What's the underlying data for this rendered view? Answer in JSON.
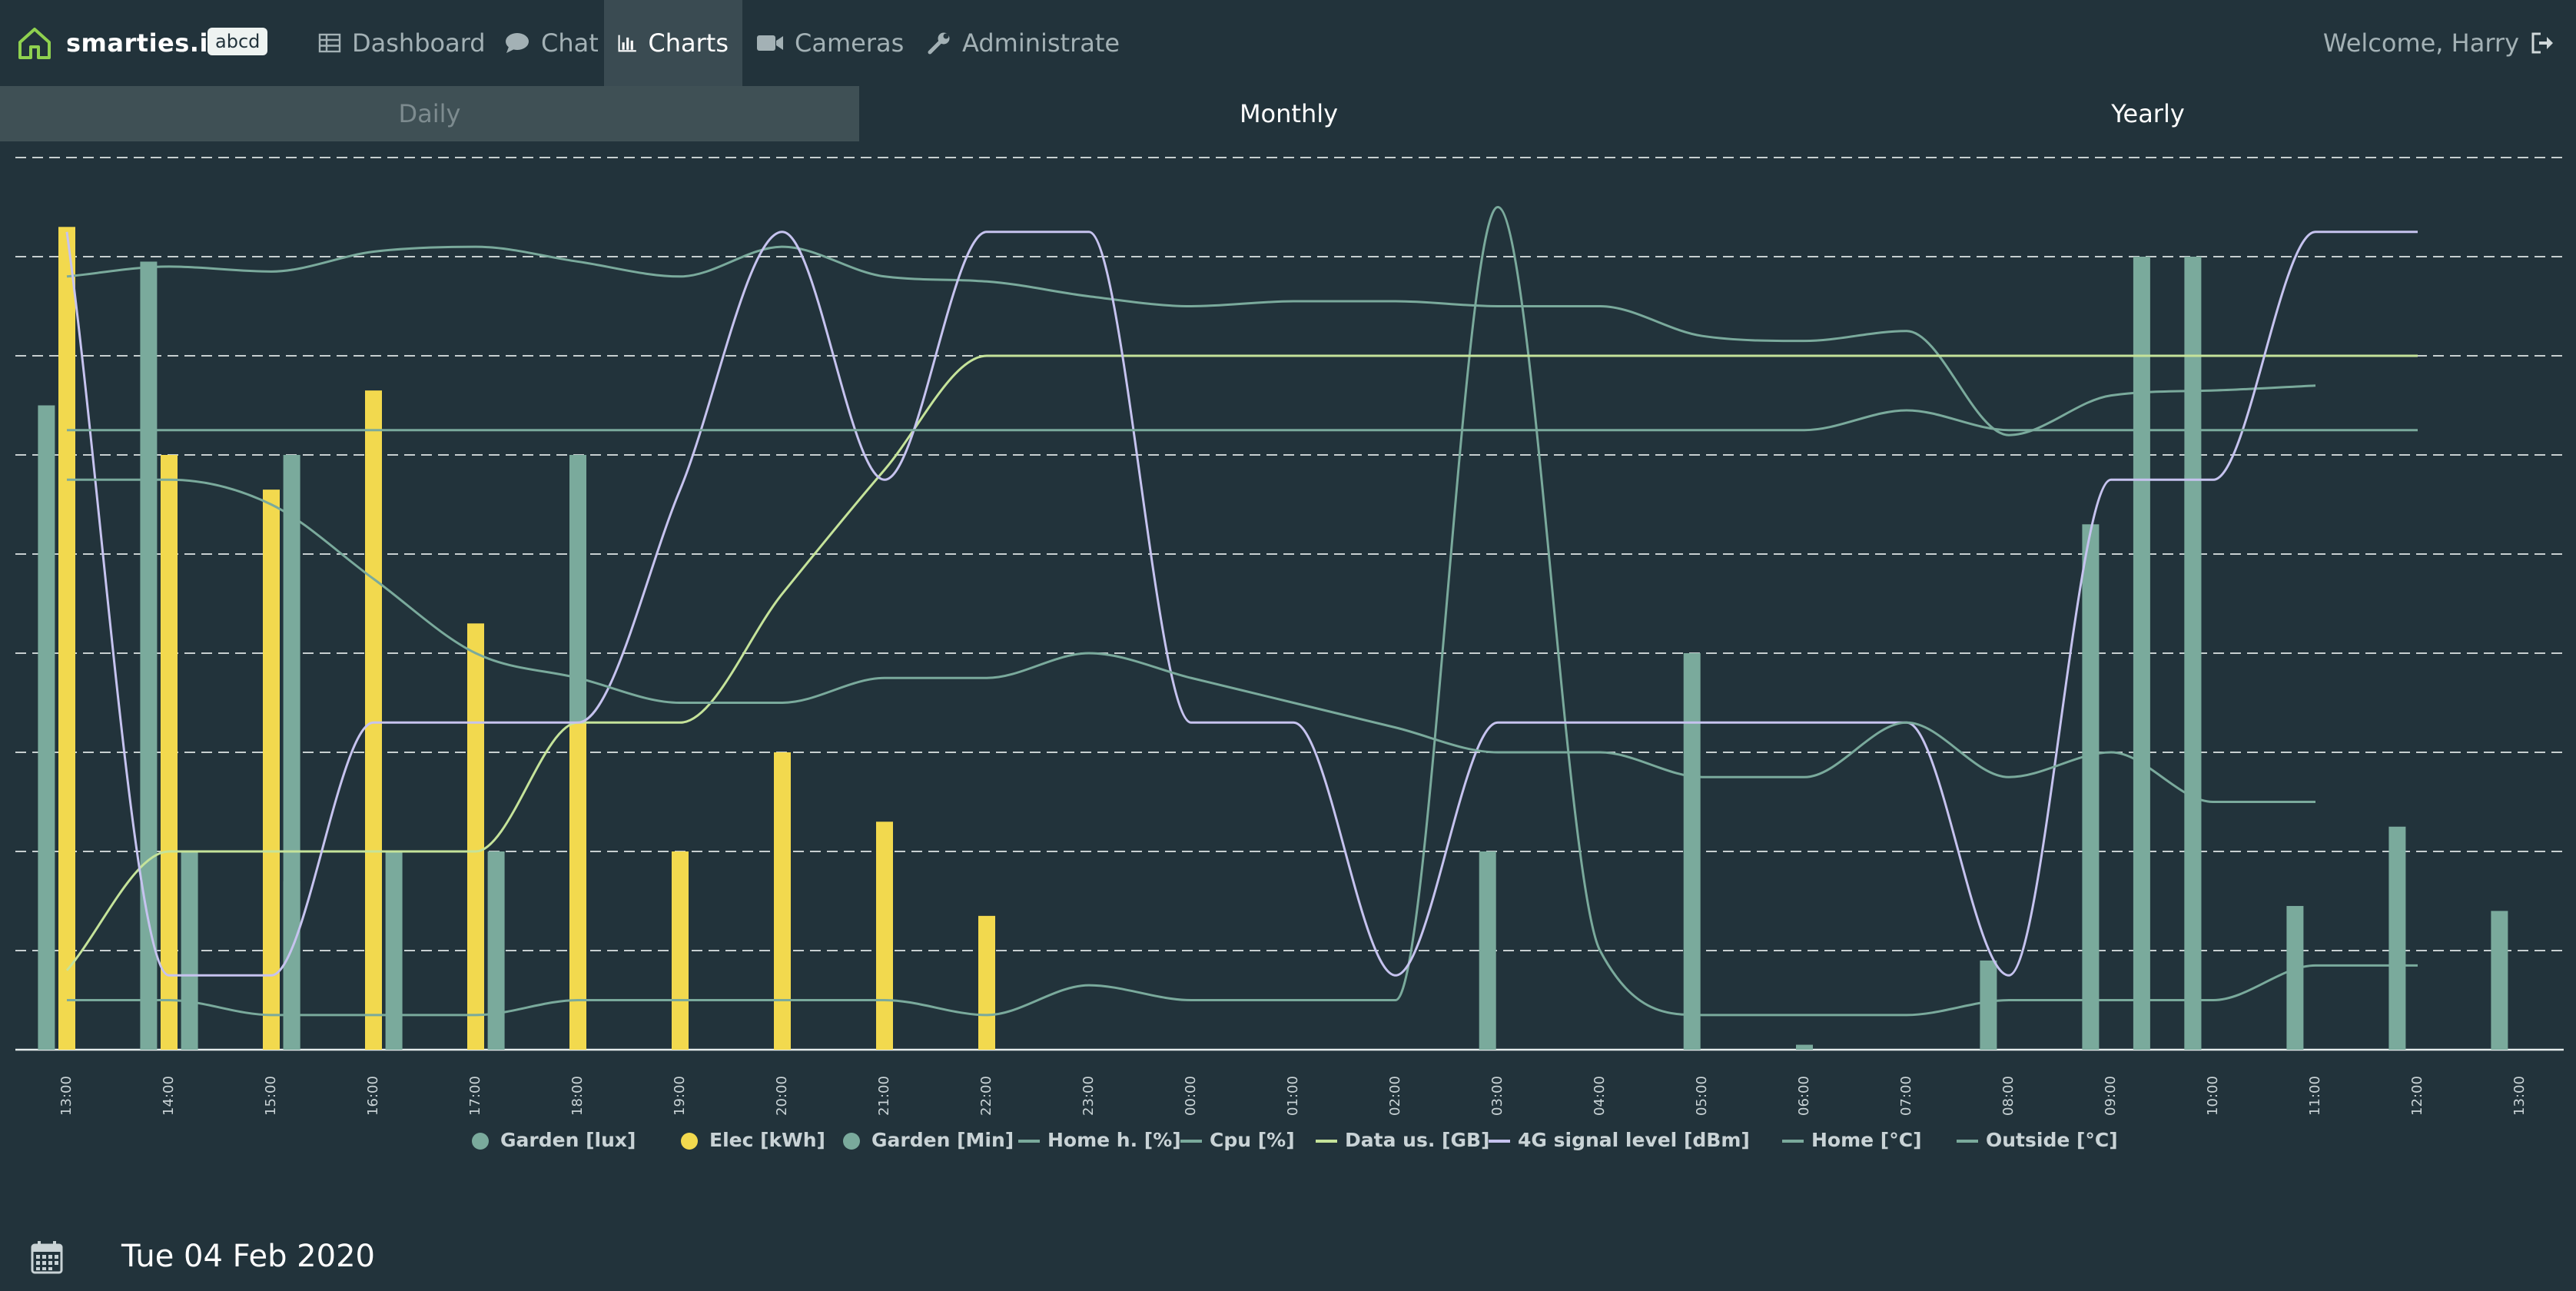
{
  "brand": {
    "name": "smarties.io",
    "badge": "abcd"
  },
  "nav": {
    "items": [
      {
        "label": "Dashboard",
        "icon": "table-icon"
      },
      {
        "label": "Chat",
        "icon": "chat-bubble-icon"
      },
      {
        "label": "Charts",
        "icon": "bar-chart-icon",
        "active": true
      },
      {
        "label": "Cameras",
        "icon": "video-camera-icon"
      },
      {
        "label": "Administrate",
        "icon": "wrench-icon"
      }
    ],
    "welcome": "Welcome, Harry",
    "logout_icon": "sign-out-icon"
  },
  "tabs": [
    {
      "label": "Daily",
      "active": true
    },
    {
      "label": "Monthly"
    },
    {
      "label": "Yearly"
    }
  ],
  "date": {
    "label": "Tue 04 Feb 2020",
    "icon": "calendar-icon"
  },
  "colors": {
    "background": "#22333b",
    "teal": "#7aaa9c",
    "yellow": "#f2d94e",
    "green_line": "#c5e39a",
    "violet_line": "#c6c3ef",
    "grid": "#e4ebeb",
    "brand_green": "#8fd14f"
  },
  "chart_data": {
    "type": "bar",
    "x": [
      "13:00",
      "14:00",
      "15:00",
      "16:00",
      "17:00",
      "18:00",
      "19:00",
      "20:00",
      "21:00",
      "22:00",
      "23:00",
      "00:00",
      "01:00",
      "02:00",
      "03:00",
      "04:00",
      "05:00",
      "06:00",
      "07:00",
      "08:00",
      "09:00",
      "10:00",
      "11:00",
      "12:00",
      "13:00"
    ],
    "ylim": [
      0,
      9
    ],
    "grid": true,
    "legend_position": "bottom",
    "series": [
      {
        "name": "Garden [lux]",
        "kind": "bar",
        "color": "#7aaa9c",
        "points": [
          [
            -0.2,
            6.5
          ],
          [
            0.8,
            7.95
          ],
          [
            2.2,
            1.7
          ],
          [
            3.0,
            0.05
          ],
          [
            5.0,
            6.0
          ],
          [
            8.0,
            0
          ],
          [
            13.9,
            2.0
          ],
          [
            15.9,
            4.0
          ],
          [
            18.8,
            0.9
          ],
          [
            19.8,
            5.3
          ],
          [
            20.8,
            5.8
          ],
          [
            21.8,
            1.45
          ],
          [
            22.8,
            2.25
          ],
          [
            23.8,
            1.4
          ]
        ]
      },
      {
        "name": "Elec [kWh]",
        "kind": "bar",
        "color": "#f2d94e",
        "points": [
          [
            0,
            8.3
          ],
          [
            1,
            6.0
          ],
          [
            2,
            5.65
          ],
          [
            3,
            6.65
          ],
          [
            4,
            4.3
          ],
          [
            5,
            3.3
          ],
          [
            6,
            2.0
          ],
          [
            7,
            3.0
          ],
          [
            8,
            2.3
          ],
          [
            9,
            1.35
          ]
        ]
      },
      {
        "name": "Garden [Min]",
        "kind": "bar",
        "color": "#7aaa9c",
        "points": [
          [
            1.2,
            2.0
          ],
          [
            2.2,
            6.0
          ],
          [
            3.2,
            2.0
          ],
          [
            4.2,
            2.0
          ],
          [
            17.0,
            0.05
          ],
          [
            20.3,
            8.0
          ],
          [
            20.8,
            8.0
          ]
        ]
      },
      {
        "name": "Home h. [%]",
        "kind": "line",
        "color": "#7aaa9c",
        "points": [
          [
            0,
            7.8
          ],
          [
            1,
            7.9
          ],
          [
            2,
            7.85
          ],
          [
            3,
            8.05
          ],
          [
            4,
            8.1
          ],
          [
            5,
            7.95
          ],
          [
            6,
            7.8
          ],
          [
            7,
            8.1
          ],
          [
            8,
            7.8
          ],
          [
            9,
            7.75
          ],
          [
            10,
            7.6
          ],
          [
            11,
            7.5
          ],
          [
            12,
            7.55
          ],
          [
            13,
            7.55
          ],
          [
            14,
            7.5
          ],
          [
            15,
            7.5
          ],
          [
            16,
            7.2
          ],
          [
            17,
            7.15
          ],
          [
            18,
            7.25
          ],
          [
            19,
            6.2
          ],
          [
            20,
            6.6
          ],
          [
            21,
            6.65
          ],
          [
            22,
            6.7
          ]
        ]
      },
      {
        "name": "Cpu [%]",
        "kind": "line",
        "color": "#7aaa9c",
        "points": [
          [
            0,
            0.5
          ],
          [
            1,
            0.5
          ],
          [
            2,
            0.35
          ],
          [
            3,
            0.35
          ],
          [
            4,
            0.35
          ],
          [
            5,
            0.5
          ],
          [
            6,
            0.5
          ],
          [
            7,
            0.5
          ],
          [
            8,
            0.5
          ],
          [
            9,
            0.35
          ],
          [
            10,
            0.65
          ],
          [
            11,
            0.5
          ],
          [
            12,
            0.5
          ],
          [
            13,
            0.5
          ],
          [
            14,
            8.5
          ],
          [
            15,
            1.0
          ],
          [
            16,
            0.35
          ],
          [
            17,
            0.35
          ],
          [
            18,
            0.35
          ],
          [
            19,
            0.5
          ],
          [
            20,
            0.5
          ],
          [
            21,
            0.5
          ],
          [
            22,
            0.85
          ],
          [
            23,
            0.85
          ]
        ]
      },
      {
        "name": "Data us. [GB]",
        "kind": "line",
        "color": "#c5e39a",
        "points": [
          [
            0,
            0.8
          ],
          [
            1,
            2.0
          ],
          [
            2,
            2.0
          ],
          [
            3,
            2.0
          ],
          [
            4,
            2.0
          ],
          [
            5,
            3.3
          ],
          [
            6,
            3.3
          ],
          [
            7,
            4.6
          ],
          [
            8,
            5.85
          ],
          [
            9,
            7.0
          ],
          [
            10,
            7.0
          ],
          [
            11,
            7.0
          ],
          [
            12,
            7.0
          ],
          [
            13,
            7.0
          ],
          [
            14,
            7.0
          ],
          [
            15,
            7.0
          ],
          [
            16,
            7.0
          ],
          [
            17,
            7.0
          ],
          [
            18,
            7.0
          ],
          [
            19,
            7.0
          ],
          [
            20,
            7.0
          ],
          [
            21,
            7.0
          ],
          [
            22,
            7.0
          ],
          [
            23,
            7.0
          ]
        ]
      },
      {
        "name": "4G signal level [dBm]",
        "kind": "line",
        "color": "#c6c3ef",
        "points": [
          [
            0,
            8.25
          ],
          [
            1,
            0.75
          ],
          [
            2,
            0.75
          ],
          [
            3,
            3.3
          ],
          [
            4,
            3.3
          ],
          [
            5,
            3.3
          ],
          [
            6,
            5.65
          ],
          [
            7,
            8.25
          ],
          [
            8,
            5.75
          ],
          [
            9,
            8.25
          ],
          [
            10,
            8.25
          ],
          [
            11,
            3.3
          ],
          [
            12,
            3.3
          ],
          [
            13,
            0.75
          ],
          [
            14,
            3.3
          ],
          [
            15,
            3.3
          ],
          [
            16,
            3.3
          ],
          [
            17,
            3.3
          ],
          [
            18,
            3.3
          ],
          [
            19,
            0.75
          ],
          [
            20,
            5.75
          ],
          [
            21,
            5.75
          ],
          [
            22,
            8.25
          ],
          [
            23,
            8.25
          ]
        ]
      },
      {
        "name": "Home [°C]",
        "kind": "line",
        "color": "#7aaa9c",
        "points": [
          [
            0,
            6.25
          ],
          [
            1,
            6.25
          ],
          [
            2,
            6.25
          ],
          [
            3,
            6.25
          ],
          [
            4,
            6.25
          ],
          [
            5,
            6.25
          ],
          [
            6,
            6.25
          ],
          [
            7,
            6.25
          ],
          [
            8,
            6.25
          ],
          [
            9,
            6.25
          ],
          [
            10,
            6.25
          ],
          [
            11,
            6.25
          ],
          [
            12,
            6.25
          ],
          [
            13,
            6.25
          ],
          [
            14,
            6.25
          ],
          [
            15,
            6.25
          ],
          [
            16,
            6.25
          ],
          [
            17,
            6.25
          ],
          [
            18,
            6.45
          ],
          [
            19,
            6.25
          ],
          [
            20,
            6.25
          ],
          [
            21,
            6.25
          ],
          [
            22,
            6.25
          ],
          [
            23,
            6.25
          ]
        ]
      },
      {
        "name": "Outside [°C]",
        "kind": "line",
        "color": "#7aaa9c",
        "points": [
          [
            0,
            5.75
          ],
          [
            1,
            5.75
          ],
          [
            2,
            5.5
          ],
          [
            3,
            4.75
          ],
          [
            4,
            4.0
          ],
          [
            5,
            3.75
          ],
          [
            6,
            3.5
          ],
          [
            7,
            3.5
          ],
          [
            8,
            3.75
          ],
          [
            9,
            3.75
          ],
          [
            10,
            4.0
          ],
          [
            11,
            3.75
          ],
          [
            12,
            3.5
          ],
          [
            13,
            3.25
          ],
          [
            14,
            3.0
          ],
          [
            15,
            3.0
          ],
          [
            16,
            2.75
          ],
          [
            17,
            2.75
          ],
          [
            18,
            3.3
          ],
          [
            19,
            2.75
          ],
          [
            20,
            3.0
          ],
          [
            21,
            2.5
          ],
          [
            22,
            2.5
          ]
        ]
      }
    ]
  }
}
